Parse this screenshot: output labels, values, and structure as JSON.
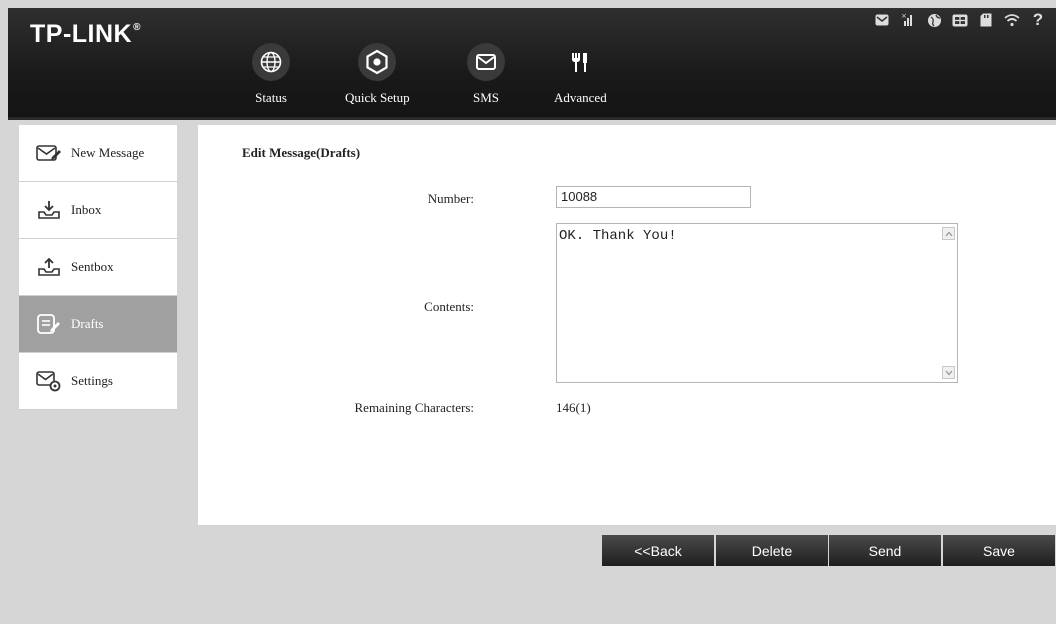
{
  "brand": {
    "name": "TP-LINK",
    "mark": "®"
  },
  "nav": [
    {
      "label": "Status",
      "icon": "globe-icon"
    },
    {
      "label": "Quick Setup",
      "icon": "gear-icon"
    },
    {
      "label": "SMS",
      "icon": "envelope-icon"
    },
    {
      "label": "Advanced",
      "icon": "tools-icon"
    }
  ],
  "status_bar": {
    "icons": [
      "message-icon",
      "signal-icon",
      "network-globe-icon",
      "sim-icon",
      "sd-card-icon",
      "wifi-icon"
    ],
    "help": "?"
  },
  "sidebar": {
    "items": [
      {
        "label": "New Message",
        "icon": "compose-icon",
        "active": false
      },
      {
        "label": "Inbox",
        "icon": "inbox-icon",
        "active": false
      },
      {
        "label": "Sentbox",
        "icon": "sentbox-icon",
        "active": false
      },
      {
        "label": "Drafts",
        "icon": "drafts-icon",
        "active": true
      },
      {
        "label": "Settings",
        "icon": "message-settings-icon",
        "active": false
      }
    ]
  },
  "form": {
    "title": "Edit Message(Drafts)",
    "number_label": "Number:",
    "number_value": "10088",
    "contents_label": "Contents:",
    "contents_value": "OK. Thank You!",
    "remaining_label": "Remaining Characters:",
    "remaining_value": "146(1)"
  },
  "buttons": {
    "back": "<<Back",
    "delete": "Delete",
    "send": "Send",
    "save": "Save"
  },
  "colors": {
    "header_bg": "#1a1a1a",
    "page_bg": "#d6d6d6",
    "active_sidebar": "#a0a0a0",
    "button_bg": "#2b2b2b"
  }
}
